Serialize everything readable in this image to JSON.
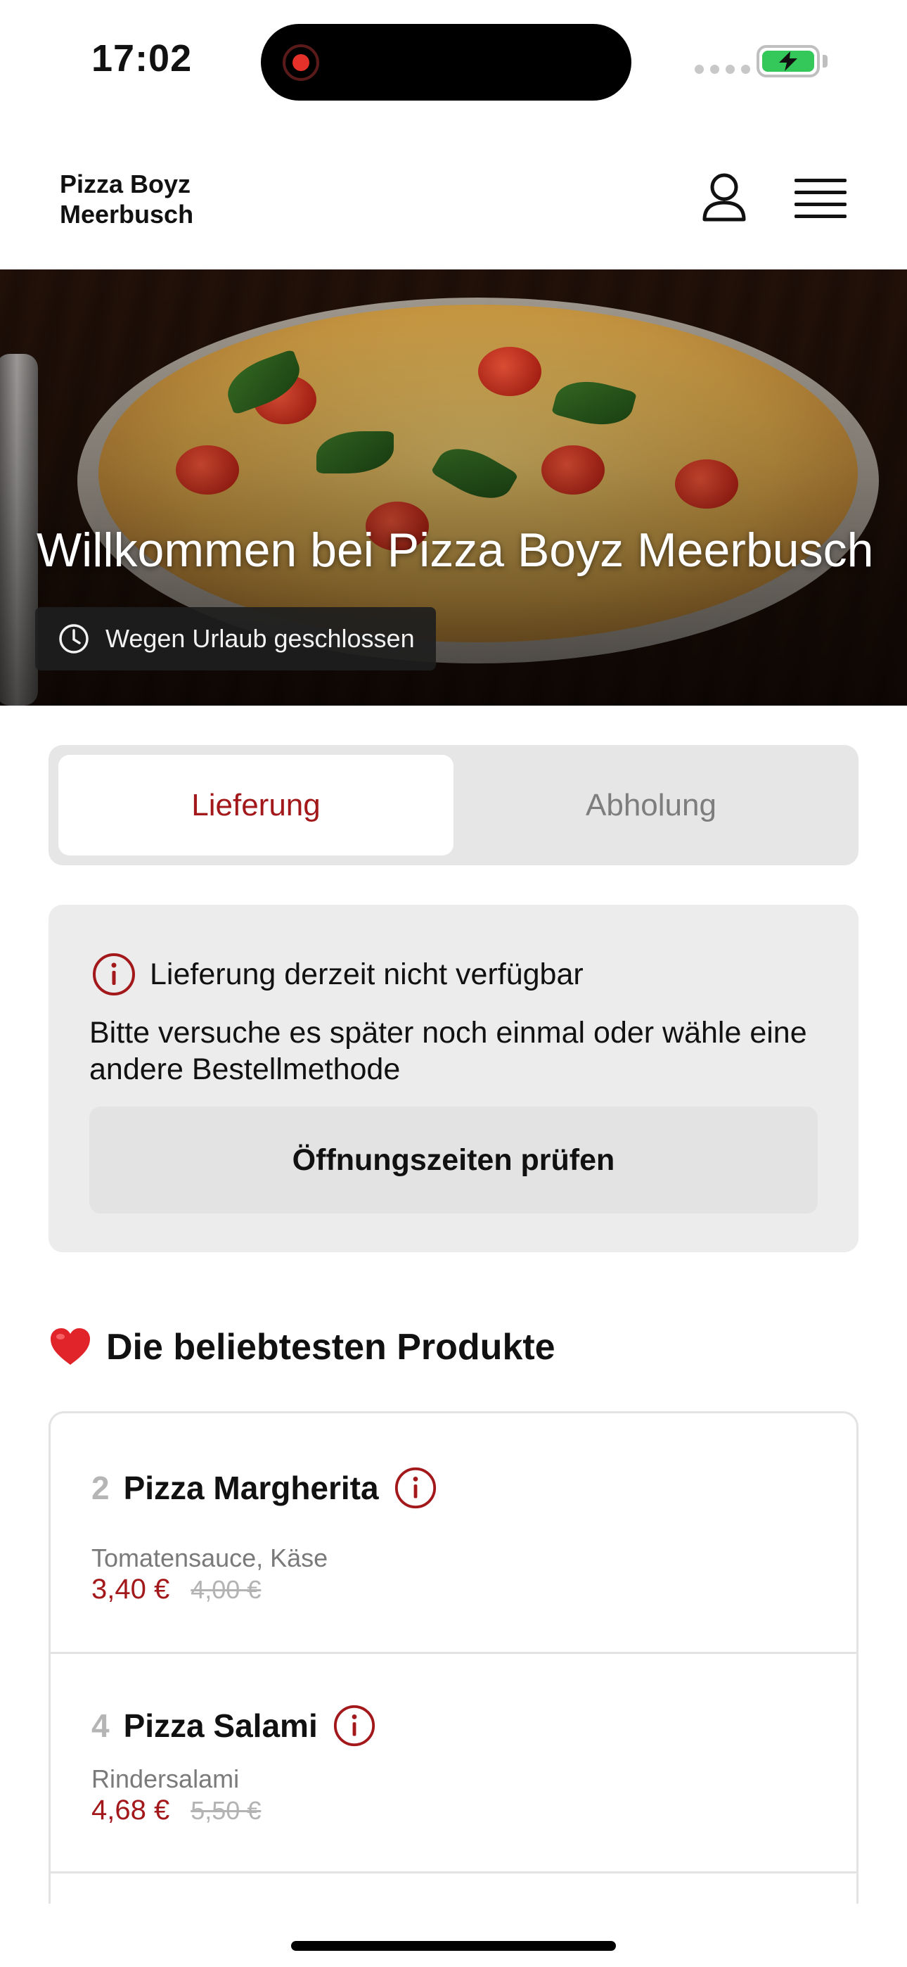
{
  "status_bar": {
    "time": "17:02"
  },
  "header": {
    "brand": "Pizza Boyz Meerbusch"
  },
  "hero": {
    "title": "Willkommen bei Pizza Boyz Meerbusch",
    "status": "Wegen Urlaub geschlossen"
  },
  "order_method": {
    "options": [
      "Lieferung",
      "Abholung"
    ],
    "selected": "Lieferung"
  },
  "notice": {
    "title": "Lieferung derzeit nicht verfügbar",
    "text": "Bitte versuche es später noch einmal oder wähle eine andere Bestellmethode",
    "button_label": "Öffnungszeiten prüfen"
  },
  "popular": {
    "title": "Die beliebtesten Produkte",
    "products": [
      {
        "number": "2",
        "name": "Pizza Margherita",
        "description": "Tomatensauce, Käse",
        "price": "3,40 €",
        "old_price": "4,00 €"
      },
      {
        "number": "4",
        "name": "Pizza Salami",
        "description": "Rindersalami",
        "price": "4,68 €",
        "old_price": "5,50 €"
      }
    ]
  },
  "colors": {
    "accent": "#a3191b",
    "battery": "#34c759"
  }
}
